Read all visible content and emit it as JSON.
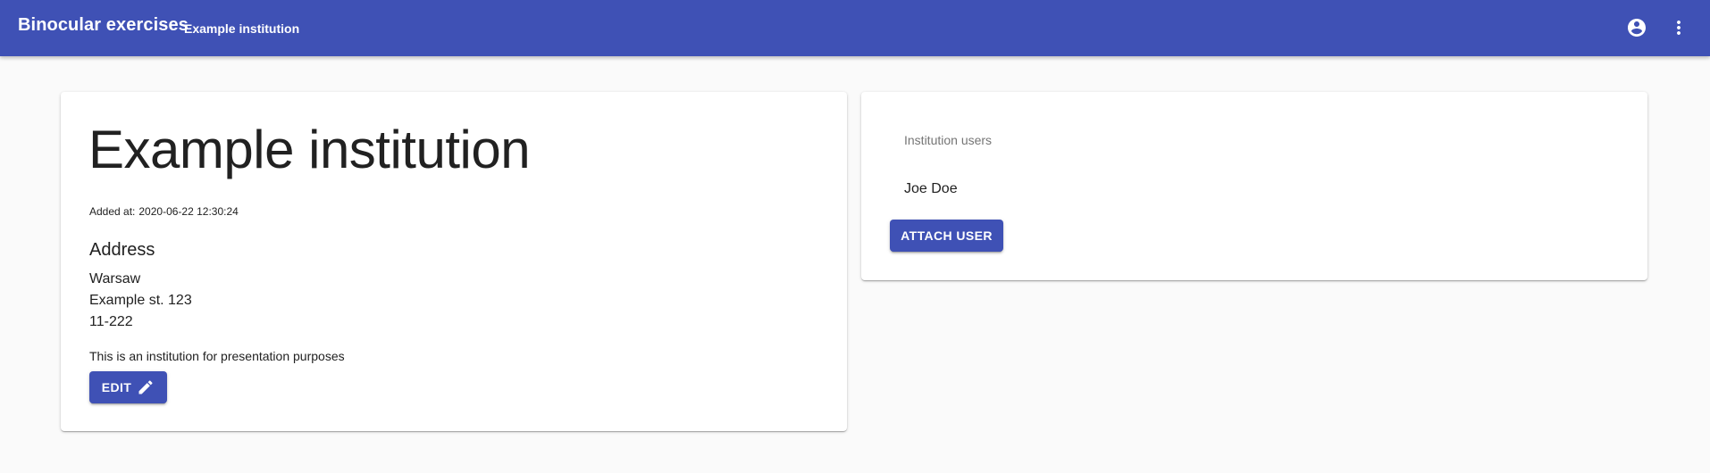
{
  "appbar": {
    "title": "Binocular exercises",
    "subtitle": "Example institution",
    "background_color": "#3f51b5",
    "icons": [
      "account-circle-icon",
      "more-vert-icon"
    ]
  },
  "institution": {
    "name": "Example institution",
    "added_at_label": "Added at:",
    "added_at_value": "2020-06-22 12:30:24",
    "address_heading": "Address",
    "address": {
      "city": "Warsaw",
      "street": "Example st. 123",
      "postal_code": "11-222"
    },
    "description": "This is an institution for presentation purposes",
    "edit_label": "EDIT"
  },
  "users_panel": {
    "label": "Institution users",
    "users": [
      "Joe Doe"
    ],
    "attach_label": "ATTACH USER"
  },
  "colors": {
    "primary": "#3f51b5",
    "page_background": "#fafafa",
    "card_background": "#ffffff"
  }
}
